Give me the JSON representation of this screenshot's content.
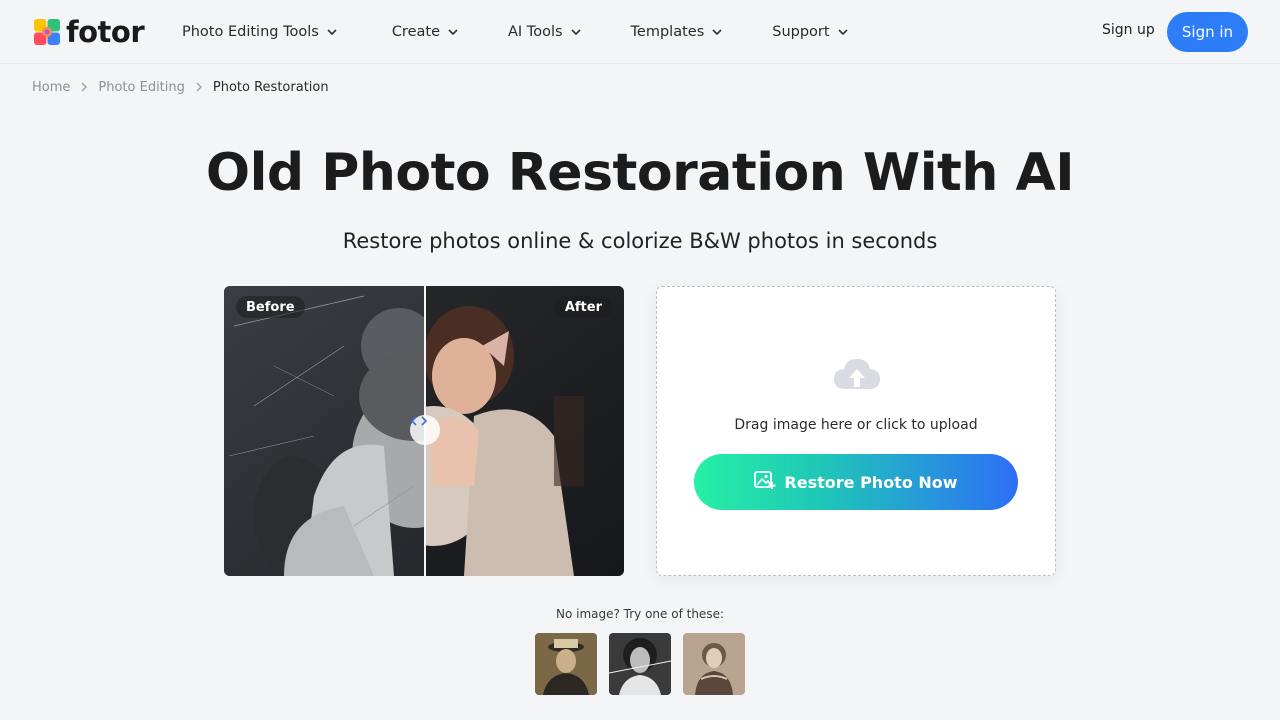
{
  "brand": {
    "name": "fotor"
  },
  "nav": {
    "items": [
      {
        "label": "Photo Editing Tools"
      },
      {
        "label": "Create"
      },
      {
        "label": "AI Tools"
      },
      {
        "label": "Templates"
      },
      {
        "label": "Support"
      }
    ],
    "signup": "Sign up",
    "signin": "Sign in"
  },
  "breadcrumb": {
    "home": "Home",
    "parent": "Photo Editing",
    "current": "Photo Restoration"
  },
  "hero": {
    "title": "Old Photo Restoration With AI",
    "subtitle": "Restore photos online & colorize B&W photos in seconds"
  },
  "compare": {
    "before_label": "Before",
    "after_label": "After"
  },
  "upload": {
    "drag_text": "Drag image here or click to upload",
    "button_label": "Restore Photo Now"
  },
  "samples": {
    "label": "No image? Try one of these:"
  },
  "colors": {
    "accent": "#2c7df7",
    "gradient_start": "#26f0a5",
    "gradient_end": "#2d6ff7"
  }
}
